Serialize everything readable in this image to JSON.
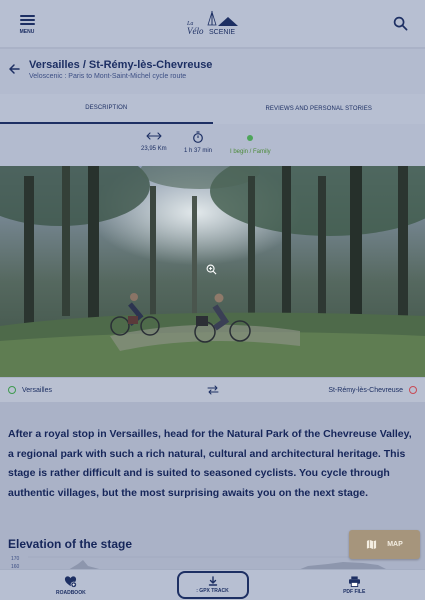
{
  "header": {
    "menu_label": "MENU",
    "logo_text_top": "La",
    "logo_text_main": "Vélo",
    "logo_text_accent": "SCENIE",
    "search_icon": "search-icon"
  },
  "route": {
    "title": "Versailles / St-Rémy-lès-Chevreuse",
    "subtitle": "Veloscenic : Paris to Mont-Saint-Michel cycle route"
  },
  "tabs": [
    {
      "label": "Description",
      "active": true
    },
    {
      "label": "Reviews and personal stories",
      "active": false
    }
  ],
  "stats": {
    "distance": "23,95 Km",
    "duration": "1 h 37 min",
    "level": "I begin / Family"
  },
  "endpoints": {
    "from": "Versailles",
    "to": "St-Rémy-lès-Chevreuse"
  },
  "description": "After a royal stop in Versailles, head for the Natural Park of the Chevreuse Valley, a regional park with such a rich natural, cultural and architectural heritage. This stage is rather difficult and is suited to seasoned cyclists. You cycle through authentic villages, but the most surprising awaits you on the next stage.",
  "elevation": {
    "title": "Elevation of the stage",
    "y_labels": [
      "170",
      "160"
    ]
  },
  "map_button": "MAP",
  "bottom_nav": {
    "roadbook": "Roadbook",
    "gpx": ": GPX track",
    "pdf": "PDF file"
  },
  "colors": {
    "primary": "#1d2f63",
    "green": "#4da55a",
    "red": "#c84a55",
    "map_button": "#a6957c"
  }
}
